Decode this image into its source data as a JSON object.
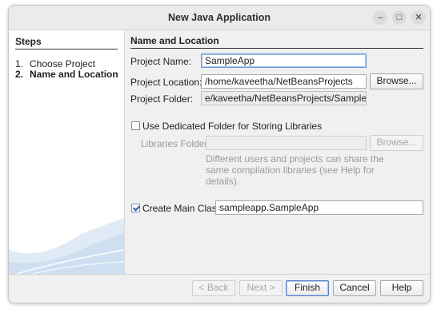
{
  "window": {
    "title": "New Java Application",
    "minimize_glyph": "–",
    "maximize_glyph": "□",
    "close_glyph": "✕"
  },
  "steps": {
    "heading": "Steps",
    "items": [
      {
        "num": "1.",
        "label": "Choose Project"
      },
      {
        "num": "2.",
        "label": "Name and Location"
      }
    ]
  },
  "panel": {
    "heading": "Name and Location",
    "project_name": {
      "label": "Project Name:",
      "value": "SampleApp"
    },
    "project_location": {
      "label": "Project Location:",
      "value": "/home/kaveetha/NetBeansProjects",
      "browse_label": "Browse..."
    },
    "project_folder": {
      "label": "Project Folder:",
      "value": "e/kaveetha/NetBeansProjects/SampleApp"
    },
    "dedicated_folder": {
      "label": "Use Dedicated Folder for Storing Libraries",
      "checked": false
    },
    "libraries_folder": {
      "label": "Libraries Folder:",
      "value": "",
      "browse_label": "Browse..."
    },
    "libraries_help": [
      "Different users and projects can share the",
      "same compilation libraries (see Help for",
      "details)."
    ],
    "main_class": {
      "label": "Create Main Class",
      "checked": true,
      "value": "sampleapp.SampleApp"
    }
  },
  "footer": {
    "back_label": "< Back",
    "next_label": "Next >",
    "finish_label": "Finish",
    "cancel_label": "Cancel",
    "help_label": "Help"
  }
}
